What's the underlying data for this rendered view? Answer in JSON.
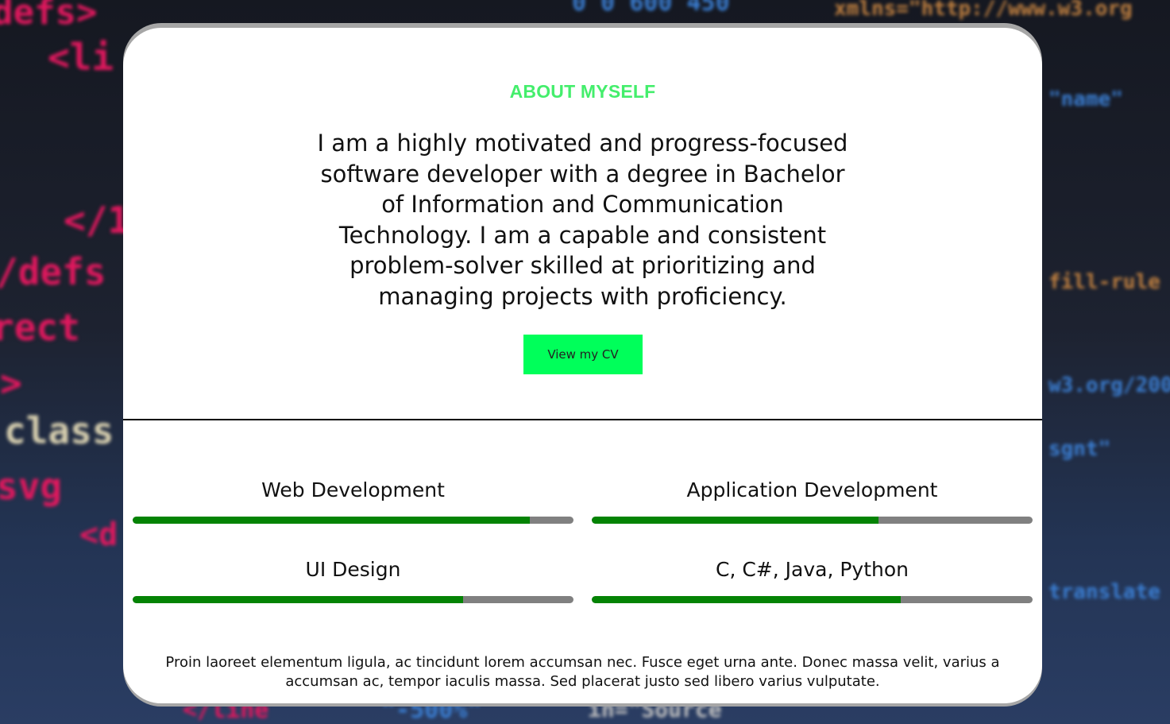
{
  "about": {
    "title": "ABOUT MYSELF",
    "description": "I am a highly motivated and progress-focused software developer with a degree in Bachelor of Information and Communication Technology. I am a capable and consistent problem-solver skilled at prioritizing and managing projects with proficiency.",
    "cv_button_label": "View my CV"
  },
  "skills": [
    {
      "name": "Web Development",
      "level": 0.9
    },
    {
      "name": "Application Development",
      "level": 0.65
    },
    {
      "name": "UI Design",
      "level": 0.75
    },
    {
      "name": "C, C#, Java, Python",
      "level": 0.7
    }
  ],
  "footer": {
    "text": "Proin laoreet elementum ligula, ac tincidunt lorem accumsan nec. Fusce eget urna ante. Donec massa velit, varius a accumsan ac, tempor iaculis massa. Sed placerat justo sed libero varius vulputate."
  },
  "colors": {
    "accent": "#44ee6c",
    "button": "#00ff5a",
    "bar_fill": "#048304",
    "bar_track": "#808080"
  }
}
